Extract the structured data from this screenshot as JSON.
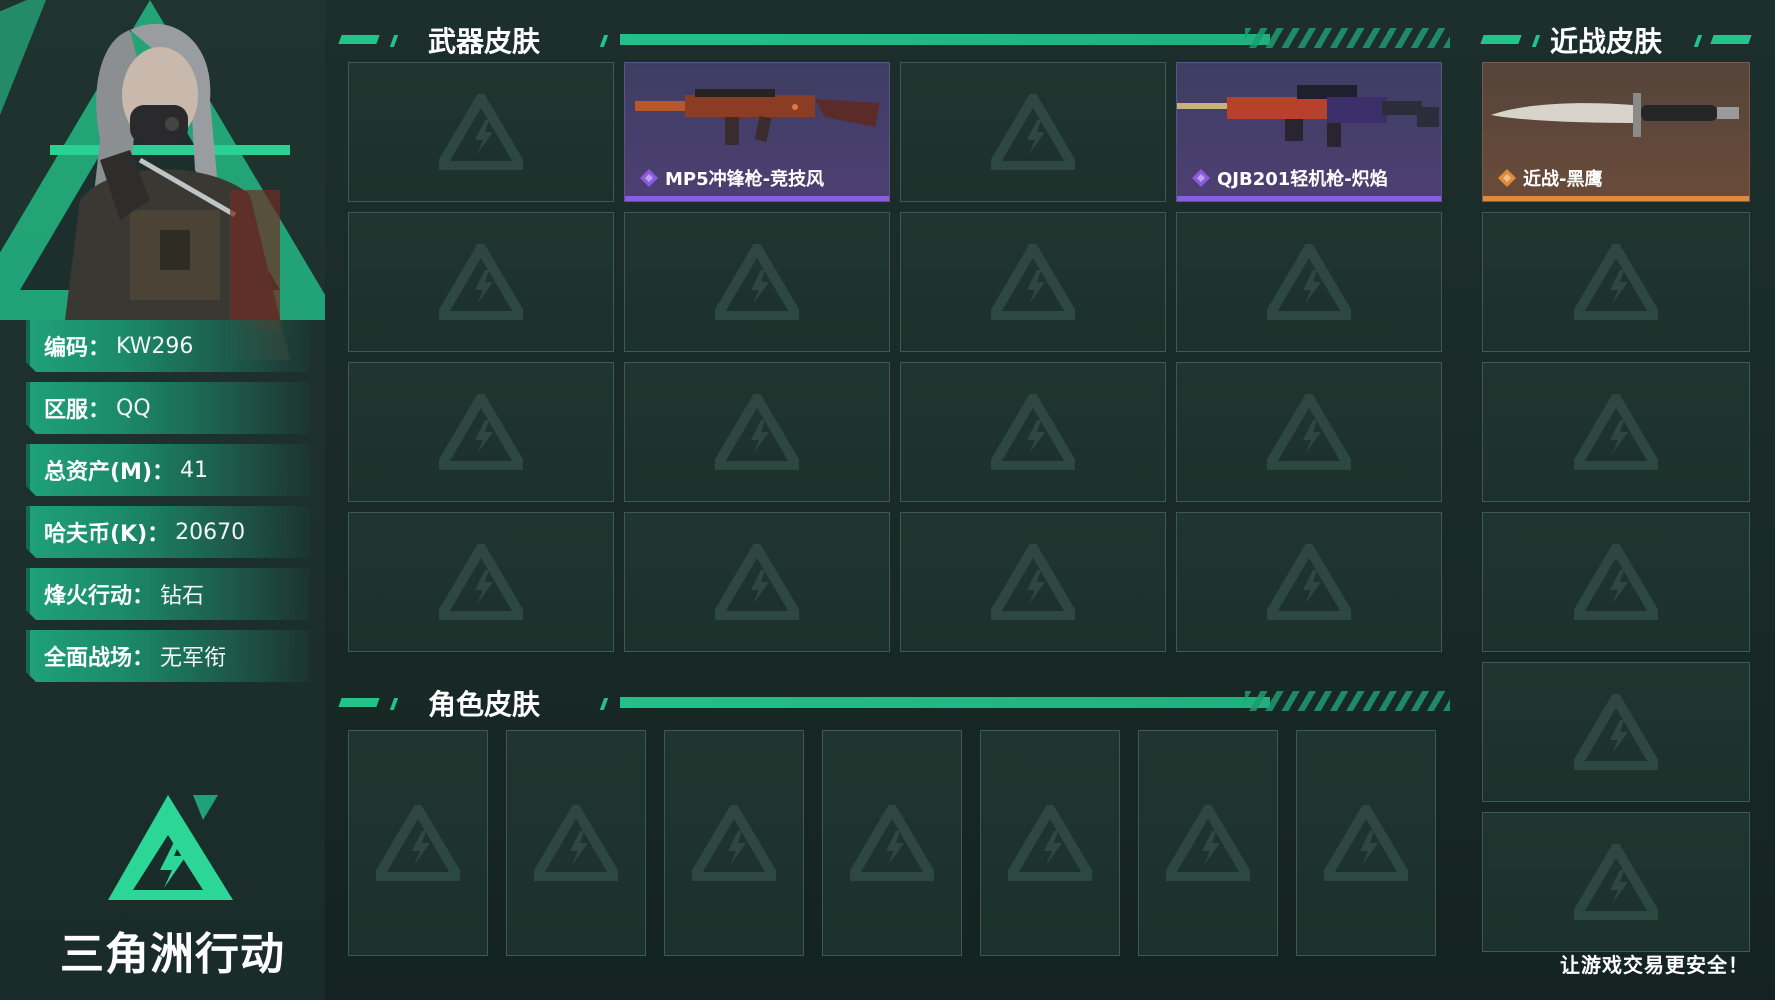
{
  "profile": {
    "fields": [
      {
        "label": "编码：",
        "value": "KW296"
      },
      {
        "label": "区服：",
        "value": "QQ"
      },
      {
        "label": "总资产(M)：",
        "value": "41"
      },
      {
        "label": "哈夫币(K)：",
        "value": "20670"
      },
      {
        "label": "烽火行动：",
        "value": "钻石"
      },
      {
        "label": "全面战场：",
        "value": "无军衔"
      }
    ]
  },
  "logo": {
    "text": "三角洲行动",
    "icon": "delta-logo-icon"
  },
  "weapon_skins": {
    "title": "武器皮肤",
    "items": [
      {
        "name": "MP5冲锋枪-竞技风",
        "rarity": "purple"
      },
      {
        "name": "QJB201轻机枪-炽焰",
        "rarity": "purple"
      }
    ]
  },
  "melee_skins": {
    "title": "近战皮肤",
    "items": [
      {
        "name": "近战-黑鹰",
        "rarity": "orange"
      }
    ]
  },
  "character_skins": {
    "title": "角色皮肤"
  },
  "footer": {
    "slogan": "让游戏交易更安全！"
  },
  "colors": {
    "accent": "#23c48a",
    "purple": "#8b5be0",
    "orange": "#e08a3b"
  }
}
